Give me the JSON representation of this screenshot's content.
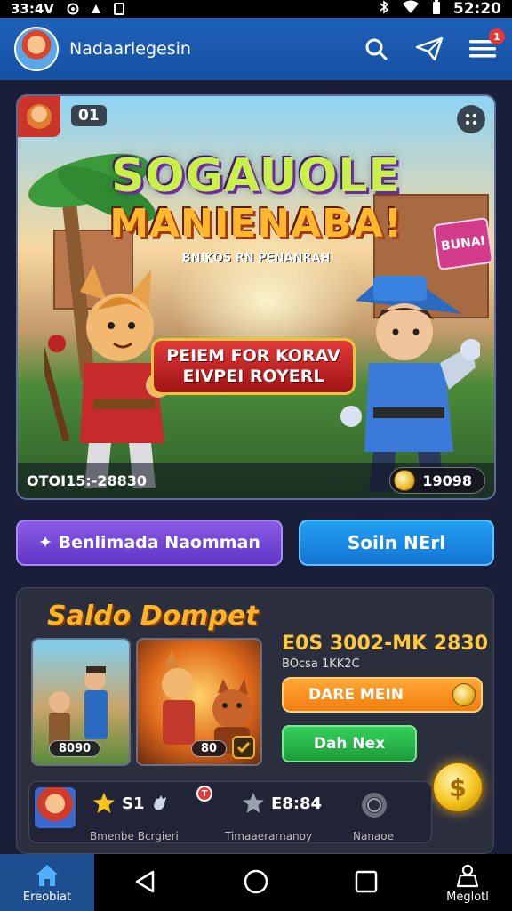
{
  "status_bar": {
    "time_left": "33:4V",
    "time_right": "52:20"
  },
  "header": {
    "title": "Nadaarlegesin",
    "notif_count": "1"
  },
  "banner": {
    "round": "01",
    "title_line1": "SOGAUOLE",
    "title_line2": "MANIENABA!",
    "subtitle": "BNIKOS RN PENANRAH",
    "cta_line1": "PEIEM FOR KORAV",
    "cta_line2": "EIVPEI ROYERL",
    "code": "OTOI15:-28830",
    "coins": "19098"
  },
  "actions": {
    "purple_label": "✦ Benlimada Naomman",
    "blue_label": "Soiln NErl"
  },
  "wallet": {
    "title": "Saldo Dompet",
    "thumb1_label": "8090",
    "thumb2_label": "80",
    "balance": "E0S 3002-MK 2830",
    "balance_sub": "BOcsa 1KK2C",
    "orange_btn": "DARE MEIN",
    "green_btn": "Dah Nex",
    "coin_symbol": "$"
  },
  "stats": {
    "stat1_value": "S1",
    "stat1_label": "Bmenbe Bcrgieri",
    "notif_badge": "T",
    "stat2_value": "E8:84",
    "stat2_label": "Timaaerarnanoy",
    "stat3_label": "Nanaoe"
  },
  "bottom_nav": {
    "home_label": "Ereobiat",
    "profile_label": "Meglotl"
  },
  "colors": {
    "header_blue": "#1f60b8",
    "accent_orange": "#ffa733",
    "accent_green": "#35d05a",
    "accent_purple": "#8a5be6"
  }
}
